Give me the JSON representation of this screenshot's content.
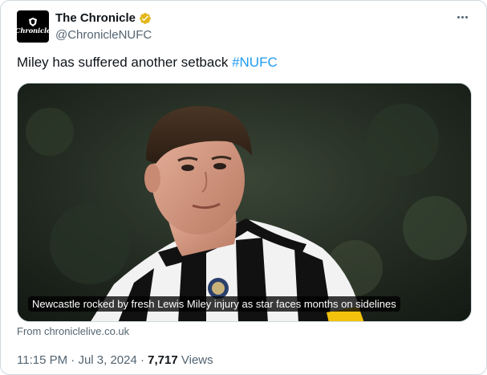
{
  "account": {
    "display_name": "The Chronicle",
    "handle": "@ChronicleNUFC",
    "avatar_logo_text": "Chronicle",
    "verified_badge_color": "#e2b719"
  },
  "tweet": {
    "text": "Miley has suffered another setback ",
    "hashtag": "#NUFC",
    "hashtag_color": "#1d9bf0"
  },
  "card": {
    "image_subject": "footballer-photo",
    "title": "Newcastle rocked by fresh Lewis Miley injury as star faces months on sidelines",
    "source": "From chroniclelive.co.uk"
  },
  "meta": {
    "time": "11:15 PM",
    "separator": " · ",
    "date": "Jul 3, 2024",
    "views_count": "7,717",
    "views_label": " Views"
  },
  "icons": {
    "verified": "verified-badge-icon",
    "more": "more-options-icon"
  }
}
